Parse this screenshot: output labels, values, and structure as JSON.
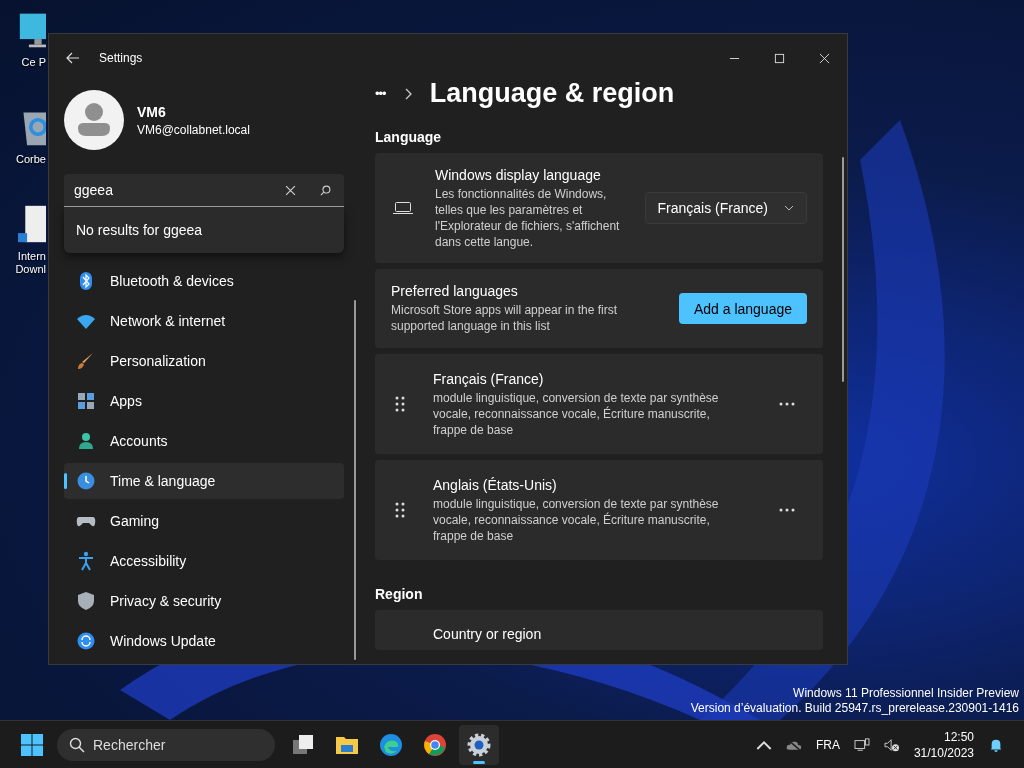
{
  "desktop_icons": [
    {
      "label": "Ce P"
    },
    {
      "label": "Corbe"
    },
    {
      "label": "Intern\nDownl"
    }
  ],
  "window": {
    "title": "Settings"
  },
  "account": {
    "name": "VM6",
    "email": "VM6@collabnet.local"
  },
  "search": {
    "value": "ggeea",
    "result": "No results for ggeea"
  },
  "sidebar": {
    "items": [
      {
        "label": "Bluetooth & devices",
        "selected": false
      },
      {
        "label": "Network & internet",
        "selected": false
      },
      {
        "label": "Personalization",
        "selected": false
      },
      {
        "label": "Apps",
        "selected": false
      },
      {
        "label": "Accounts",
        "selected": false
      },
      {
        "label": "Time & language",
        "selected": true
      },
      {
        "label": "Gaming",
        "selected": false
      },
      {
        "label": "Accessibility",
        "selected": false
      },
      {
        "label": "Privacy & security",
        "selected": false
      },
      {
        "label": "Windows Update",
        "selected": false
      }
    ]
  },
  "breadcrumb": {
    "more": "•••",
    "title": "Language & region"
  },
  "sections": [
    {
      "heading": "Language",
      "rows": [
        {
          "kind": "display",
          "title": "Windows display language",
          "description": "Les fonctionnalités de Windows, telles que les paramètres et l'Explorateur de fichiers, s'affichent dans cette langue.",
          "value": "Français (France)"
        },
        {
          "kind": "preferred",
          "title": "Preferred languages",
          "description": "Microsoft Store apps will appear in the first supported language in this list",
          "button": "Add a language"
        },
        {
          "kind": "language",
          "title": "Français (France)",
          "description": "module linguistique, conversion de texte par synthèse vocale, reconnaissance vocale, Écriture manuscrite, frappe de base"
        },
        {
          "kind": "language",
          "title": "Anglais (États-Unis)",
          "description": "module linguistique, conversion de texte par synthèse vocale, reconnaissance vocale, Écriture manuscrite, frappe de base"
        }
      ]
    },
    {
      "heading": "Region",
      "rows": [
        {
          "kind": "plain",
          "title": "Country or region"
        }
      ]
    }
  ],
  "watermark": [
    "Windows 11 Professionnel Insider Preview",
    "Version d’évaluation. Build 25947.rs_prerelease.230901-1416"
  ],
  "taskbar": {
    "search_placeholder": "Rechercher",
    "apps": [
      {
        "selected": false
      },
      {
        "selected": false
      },
      {
        "selected": false
      },
      {
        "selected": false
      },
      {
        "selected": true
      }
    ],
    "language": "FRA",
    "time": "12:50",
    "date": "31/10/2023"
  }
}
